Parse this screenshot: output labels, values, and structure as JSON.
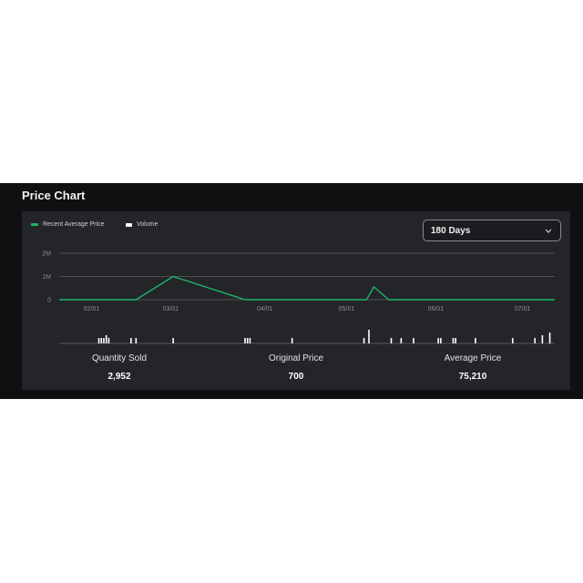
{
  "panel": {
    "title": "Price Chart"
  },
  "legend": [
    {
      "label": "Recent Average Price",
      "color": "#1db36a"
    },
    {
      "label": "Volume",
      "color": "#ffffff"
    }
  ],
  "range": {
    "selected": "180 Days",
    "icon": "chevron-down-icon"
  },
  "chart_data": {
    "type": "line",
    "series": [
      {
        "name": "Recent Average Price",
        "color": "#1db36a",
        "points": [
          [
            0,
            0
          ],
          [
            31,
            0
          ],
          [
            46,
            1000000
          ],
          [
            75,
            0
          ],
          [
            124,
            0
          ],
          [
            127,
            550000
          ],
          [
            133,
            0
          ],
          [
            160,
            0
          ],
          [
            200,
            0
          ]
        ]
      },
      {
        "name": "Volume",
        "type": "bar",
        "color": "#ffffff",
        "points": [
          [
            16,
            1
          ],
          [
            17,
            1
          ],
          [
            18,
            1
          ],
          [
            19,
            1.5
          ],
          [
            20,
            1
          ],
          [
            29,
            1
          ],
          [
            31,
            1
          ],
          [
            46,
            1
          ],
          [
            75,
            1
          ],
          [
            76,
            1
          ],
          [
            77,
            1
          ],
          [
            94,
            1
          ],
          [
            123,
            1
          ],
          [
            125,
            2.5
          ],
          [
            134,
            1
          ],
          [
            138,
            1
          ],
          [
            143,
            1
          ],
          [
            153,
            1
          ],
          [
            154,
            1
          ],
          [
            159,
            1
          ],
          [
            160,
            1
          ],
          [
            168,
            1
          ],
          [
            183,
            1
          ],
          [
            192,
            1
          ],
          [
            195,
            1.5
          ],
          [
            198,
            2
          ]
        ]
      }
    ],
    "x_ticks": [
      {
        "x": 13,
        "label": "02/01"
      },
      {
        "x": 45,
        "label": "03/01"
      },
      {
        "x": 83,
        "label": "04/01"
      },
      {
        "x": 116,
        "label": "05/01"
      },
      {
        "x": 152,
        "label": "06/01"
      },
      {
        "x": 187,
        "label": "07/01"
      }
    ],
    "y_ticks": [
      {
        "y": 2000000,
        "label": "2M"
      },
      {
        "y": 1000000,
        "label": "1M"
      },
      {
        "y": 0,
        "label": "0"
      }
    ],
    "xlim": [
      0,
      200
    ],
    "ylim": [
      0,
      2000000
    ],
    "grid": true,
    "legend": "top-left"
  },
  "stats": [
    {
      "label": "Quantity Sold",
      "value": "2,952"
    },
    {
      "label": "Original Price",
      "value": "700"
    },
    {
      "label": "Average Price",
      "value": "75,210"
    }
  ]
}
